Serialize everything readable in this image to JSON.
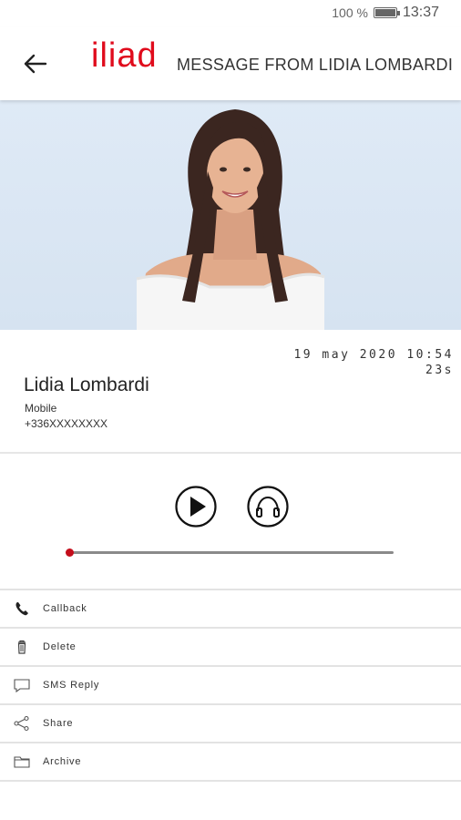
{
  "status_bar": {
    "battery_percent": "100 %",
    "time": "13:37"
  },
  "header": {
    "logo": "iliad",
    "title": "MESSAGE FROM LIDIA LOMBARDI",
    "brand_color": "#e00b1c"
  },
  "message": {
    "date": "19 may 2020 10:54",
    "duration": "23s",
    "contact_name": "Lidia Lombardi",
    "contact_type": "Mobile",
    "contact_number": "+336XXXXXXXX"
  },
  "player": {
    "progress": 0.0,
    "accent_color": "#c40d1b"
  },
  "actions": [
    {
      "label": "Callback",
      "icon": "phone-icon"
    },
    {
      "label": "Delete",
      "icon": "trash-icon"
    },
    {
      "label": "SMS Reply",
      "icon": "chat-icon"
    },
    {
      "label": "Share",
      "icon": "share-icon"
    },
    {
      "label": "Archive",
      "icon": "folder-icon"
    }
  ]
}
